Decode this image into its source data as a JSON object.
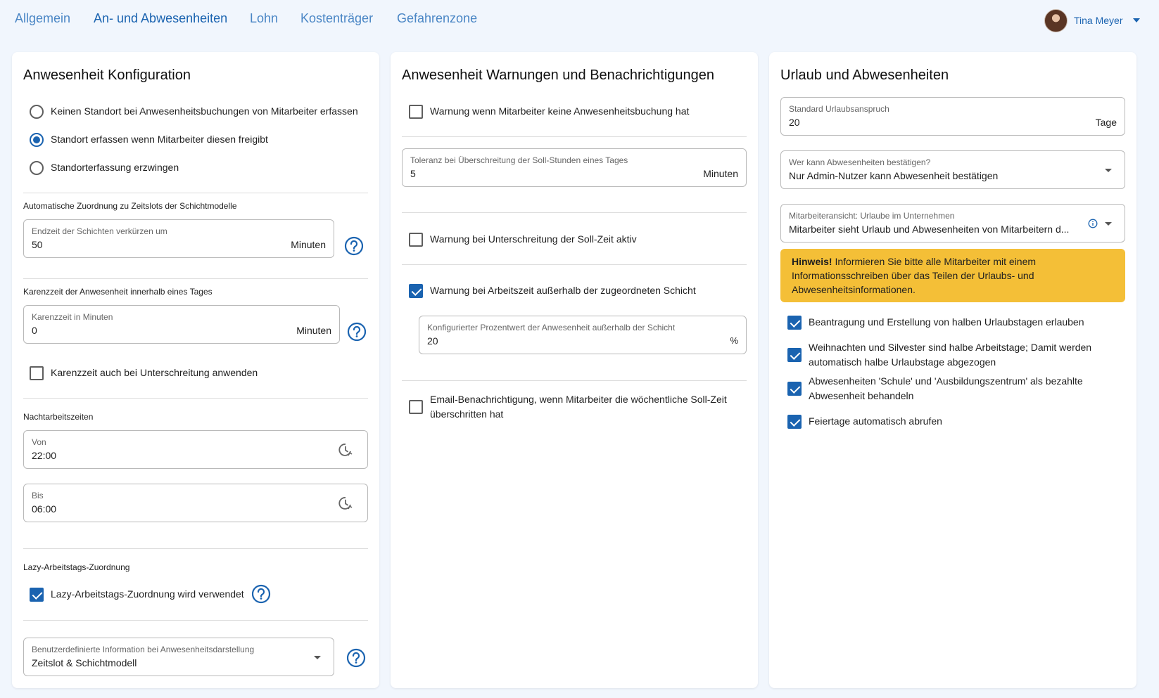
{
  "nav": {
    "tabs": [
      {
        "label": "Allgemein"
      },
      {
        "label": "An- und Abwesenheiten"
      },
      {
        "label": "Lohn"
      },
      {
        "label": "Kostenträger"
      },
      {
        "label": "Gefahrenzone"
      }
    ],
    "active_tab": 1,
    "user_name": "Tina Meyer"
  },
  "config": {
    "title": "Anwesenheit Konfiguration",
    "location_options": [
      {
        "label": "Keinen Standort bei Anwesenheitsbuchungen von Mitarbeiter erfassen",
        "selected": false
      },
      {
        "label": "Standort erfassen wenn Mitarbeiter diesen freigibt",
        "selected": true
      },
      {
        "label": "Standorterfassung erzwingen",
        "selected": false
      }
    ],
    "shift_section": "Automatische Zuordnung zu Zeitslots der Schichtmodelle",
    "shift_field": {
      "label": "Endzeit der Schichten verkürzen um",
      "value": "50",
      "suffix": "Minuten"
    },
    "grace_section": "Karenzzeit der Anwesenheit innerhalb eines Tages",
    "grace_field": {
      "label": "Karenzzeit in Minuten",
      "value": "0",
      "suffix": "Minuten"
    },
    "grace_check": {
      "label": "Karenzzeit auch bei Unterschreitung anwenden",
      "checked": false
    },
    "night_section": "Nachtarbeitszeiten",
    "night_from": {
      "label": "Von",
      "value": "22:00"
    },
    "night_to": {
      "label": "Bis",
      "value": "06:00"
    },
    "lazy_section": "Lazy-Arbeitstags-Zuordnung",
    "lazy_check": {
      "label": "Lazy-Arbeitstags-Zuordnung wird verwendet",
      "checked": true
    },
    "custom_info": {
      "label": "Benutzerdefinierte Information bei Anwesenheitsdarstellung",
      "value": "Zeitslot & Schichtmodell"
    }
  },
  "warnings": {
    "title": "Anwesenheit Warnungen und Benachrichtigungen",
    "no_booking": {
      "label": "Warnung wenn Mitarbeiter keine Anwesenheitsbuchung hat",
      "checked": false
    },
    "tolerance": {
      "label": "Toleranz bei Überschreitung der Soll-Stunden eines Tages",
      "value": "5",
      "suffix": "Minuten"
    },
    "under_target": {
      "label": "Warnung bei Unterschreitung der Soll-Zeit aktiv",
      "checked": false
    },
    "outside_shift": {
      "label": "Warnung bei Arbeitszeit außerhalb der zugeordneten Schicht",
      "checked": true
    },
    "percent": {
      "label": "Konfigurierter Prozentwert der Anwesenheit außerhalb der Schicht",
      "value": "20",
      "suffix": "%"
    },
    "email": {
      "label_line1": "Email-Benachrichtigung, wenn Mitarbeiter die wöchentliche Soll-Zeit",
      "label_line2": "überschritten hat",
      "checked": false
    }
  },
  "vacation": {
    "title": "Urlaub und Abwesenheiten",
    "entitlement": {
      "label": "Standard Urlaubsanspruch",
      "value": "20",
      "suffix": "Tage"
    },
    "approver": {
      "label": "Wer kann Abwesenheiten bestätigen?",
      "value": "Nur Admin-Nutzer kann Abwesenheit bestätigen"
    },
    "employee_view": {
      "label": "Mitarbeiteransicht: Urlaube im Unternehmen",
      "value": "Mitarbeiter sieht Urlaub und Abwesenheiten von Mitarbeitern d..."
    },
    "hint": {
      "bold": "Hinweis!",
      "text": " Informieren Sie bitte alle Mitarbeiter mit einem Informationsschreiben über das Teilen der Urlaubs- und Abwesenheitsinformationen."
    },
    "checks": [
      {
        "line1": "Beantragung und Erstellung von halben Urlaubstagen erlauben",
        "line2": "",
        "checked": true
      },
      {
        "line1": "Weihnachten und Silvester sind halbe Arbeitstage; Damit werden",
        "line2": "automatisch halbe Urlaubstage abgezogen",
        "checked": true
      },
      {
        "line1": "Abwesenheiten 'Schule' und 'Ausbildungszentrum' als bezahlte",
        "line2": "Abwesenheit behandeln",
        "checked": true
      },
      {
        "line1": "Feiertage automatisch abrufen",
        "line2": "",
        "checked": true
      }
    ]
  }
}
